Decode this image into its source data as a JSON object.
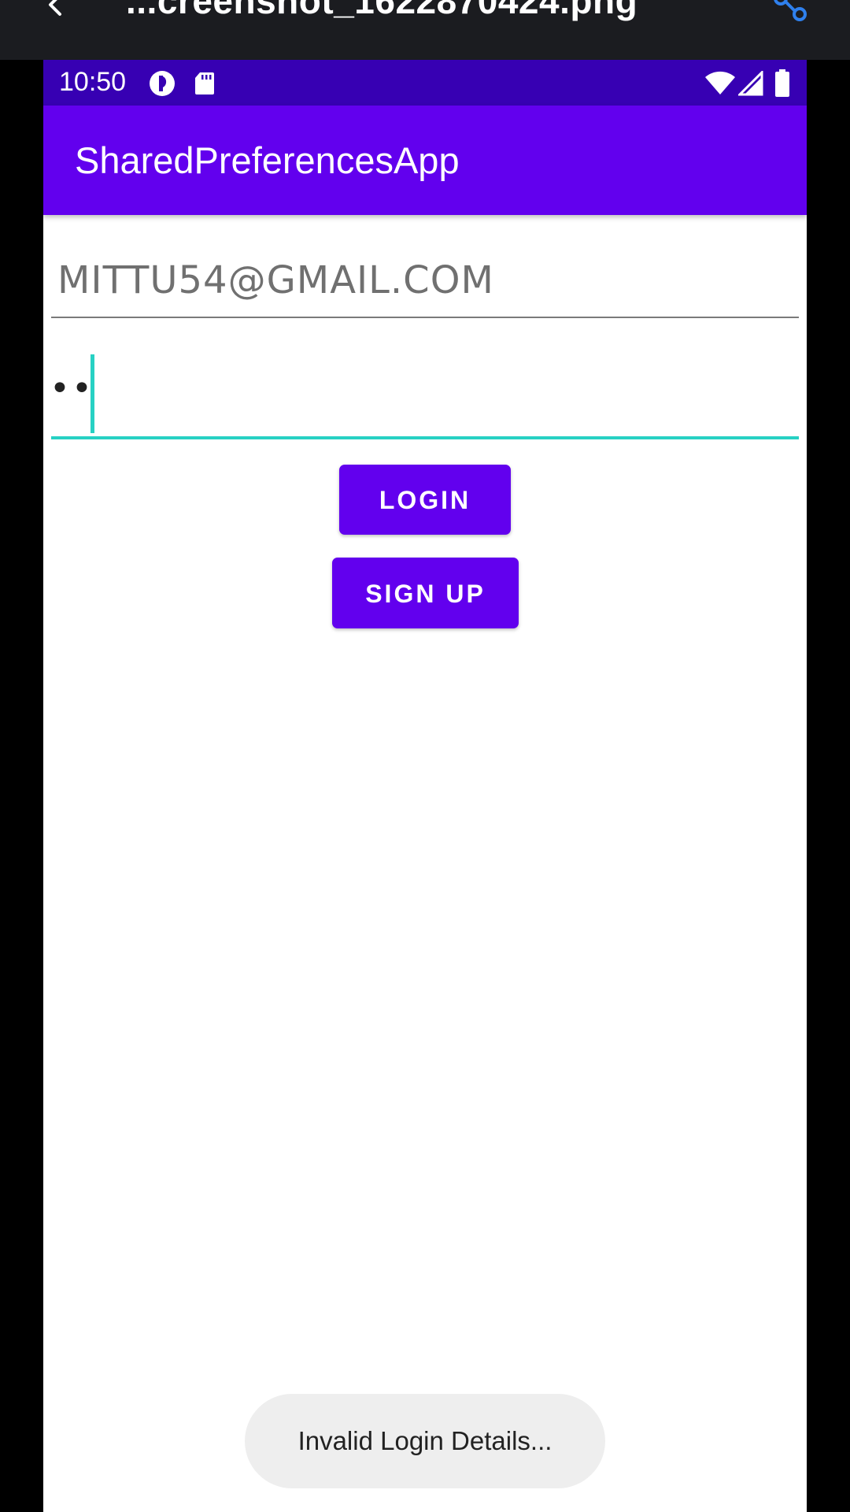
{
  "viewer": {
    "file_name": "...creenshot_1622870424.png",
    "back_icon": "back-arrow-icon",
    "share_icon": "share-icon",
    "share_color": "#2f80ed"
  },
  "status_bar": {
    "time": "10:50",
    "icons": [
      "app-notification-icon",
      "sd-card-icon",
      "wifi-icon",
      "signal-icon",
      "battery-icon"
    ],
    "color": "#3700b3"
  },
  "app_bar": {
    "title": "SharedPreferencesApp",
    "color": "#6200ee"
  },
  "form": {
    "email_value": "MITTU54@GMAIL.COM",
    "password_value": "••",
    "login_label": "LOGIN",
    "signup_label": "SIGN UP",
    "accent_color": "#27d1c3"
  },
  "toast": {
    "message": "Invalid Login Details..."
  }
}
